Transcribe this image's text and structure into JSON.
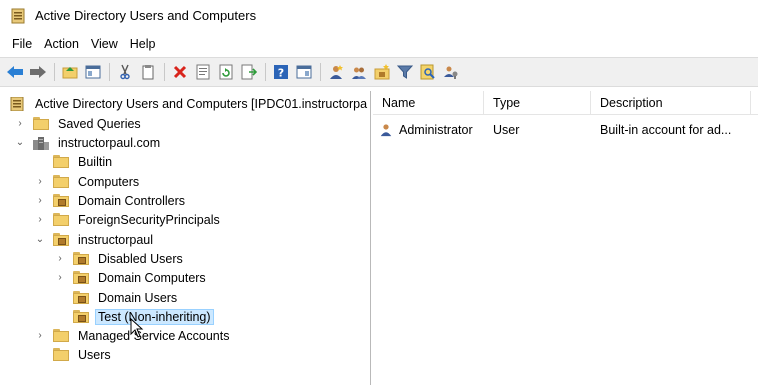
{
  "window": {
    "title": "Active Directory Users and Computers"
  },
  "menu": [
    "File",
    "Action",
    "View",
    "Help"
  ],
  "toolbar": {
    "buttons": [
      "back-icon",
      "forward-icon",
      "up-folder-icon",
      "show-tree-icon",
      "cut-icon",
      "copy-icon",
      "delete-icon",
      "properties-icon",
      "refresh-icon",
      "export-list-icon",
      "help-icon",
      "console-icon",
      "new-user-icon",
      "new-group-icon",
      "new-ou-icon",
      "filter-icon",
      "find-icon",
      "delegate-icon"
    ]
  },
  "tree": {
    "root": "Active Directory Users and Computers [IPDC01.instructorpa",
    "saved_queries": "Saved Queries",
    "domain": "instructorpaul.com",
    "builtin": "Builtin",
    "computers": "Computers",
    "domain_controllers": "Domain Controllers",
    "foreign_security_principals": "ForeignSecurityPrincipals",
    "ou_instructorpaul": "instructorpaul",
    "disabled_users": "Disabled Users",
    "domain_computers": "Domain Computers",
    "domain_users": "Domain Users",
    "test": "Test (Non-inheriting)",
    "managed_service_accounts": "Managed Service Accounts",
    "users": "Users"
  },
  "list": {
    "columns": [
      "Name",
      "Type",
      "Description"
    ],
    "rows": [
      {
        "name": "Administrator",
        "type": "User",
        "description": "Built-in account for ad..."
      }
    ]
  },
  "colors": {
    "selection": "#cce8ff",
    "folder": "#f3cf6b",
    "toolbar": "#f0f0f0"
  }
}
